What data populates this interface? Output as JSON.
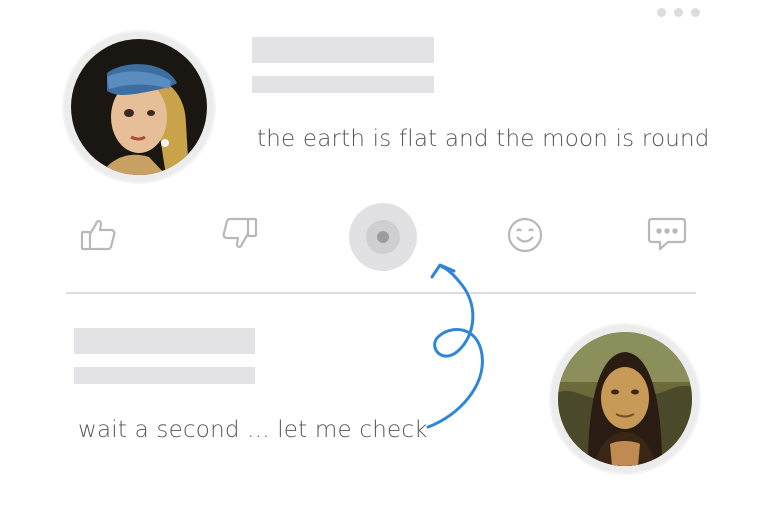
{
  "top_post": {
    "avatar_icon": "girl-with-pearl-earring-portrait",
    "message": "the earth is flat and the moon is round"
  },
  "actions": {
    "icons": [
      "thumbs-up-icon",
      "thumbs-down-icon",
      "record-icon",
      "smile-icon",
      "comment-icon"
    ]
  },
  "bottom_post": {
    "avatar_icon": "mona-lisa-portrait",
    "message": "wait a second ... let me check"
  },
  "window": {
    "menu_icon": "more-dots-icon"
  },
  "colors": {
    "placeholder": "#e3e3e6",
    "divider": "#dcdcdc",
    "arrow": "#2f86d8",
    "icon_stroke": "#b8b8b8",
    "text": "#555555"
  }
}
